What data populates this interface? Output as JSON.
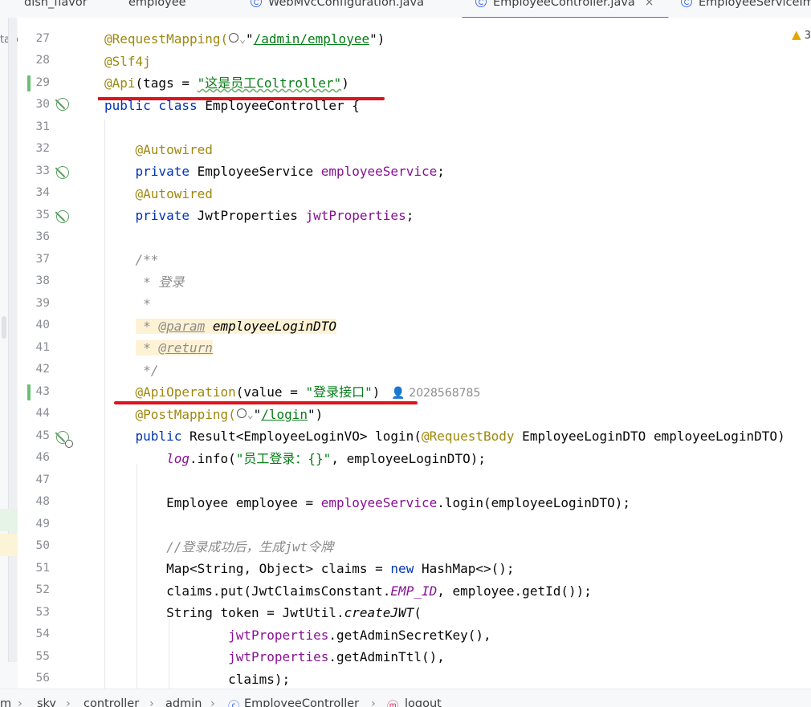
{
  "tabs": [
    {
      "label": "dish_flavor",
      "icon": "none",
      "active": false
    },
    {
      "label": "employee",
      "icon": "none",
      "active": false
    },
    {
      "label": "WebMvcConfiguration.java",
      "icon": "class-icon",
      "active": false
    },
    {
      "label": "EmployeeController.java",
      "icon": "class-icon",
      "active": true,
      "close": "×"
    },
    {
      "label": "EmployeeServiceIm",
      "icon": "class-icon",
      "active": false
    }
  ],
  "left_strip": {
    "fragment": "take"
  },
  "warnings": {
    "count": "3"
  },
  "line_numbers": [
    "27",
    "28",
    "29",
    "30",
    "31",
    "32",
    "33",
    "34",
    "35",
    "36",
    "37",
    "38",
    "39",
    "40",
    "41",
    "42",
    "43",
    "44",
    "45",
    "46",
    "47",
    "48",
    "49",
    "50",
    "51",
    "52",
    "53",
    "54",
    "55",
    "56"
  ],
  "code": {
    "l27": {
      "ann": "@RequestMapping(",
      "url": "/admin/employee",
      "end": "\")"
    },
    "l28": {
      "ann": "@Slf4j"
    },
    "l29": {
      "ann": "@Api",
      "mid": "(tags = ",
      "str": "\"这是员工Coltroller\"",
      "end": ")"
    },
    "l30": {
      "kw": "public class",
      "rest": " EmployeeController {"
    },
    "l32": {
      "ann": "@Autowired"
    },
    "l33": {
      "kw": "private",
      "type": " EmployeeService ",
      "field": "employeeService",
      "end": ";"
    },
    "l34": {
      "ann": "@Autowired"
    },
    "l35": {
      "kw": "private",
      "type": " JwtProperties ",
      "field": "jwtProperties",
      "end": ";"
    },
    "l37": {
      "doc": "/**"
    },
    "l38": {
      "doc": " * 登录"
    },
    "l39": {
      "doc": " *"
    },
    "l40": {
      "star": " * ",
      "tag": "@param",
      "param": "employeeLoginDTO"
    },
    "l41": {
      "star": " * ",
      "tag": "@return"
    },
    "l42": {
      "doc": " */"
    },
    "l43": {
      "ann": "@ApiOperation",
      "mid": "(value = ",
      "str": "\"登录接口\"",
      "end": ")",
      "author": "2028568785"
    },
    "l44": {
      "ann": "@PostMapping(",
      "url": "/login",
      "end": "\")"
    },
    "l45": {
      "kw": "public",
      "a": " Result<EmployeeLoginVO> login(",
      "ann": "@RequestBody",
      "b": " EmployeeLoginDTO employeeLoginDTO)"
    },
    "l46": {
      "field": "log",
      "a": ".info(",
      "str": "\"员工登录：{}\"",
      "b": ", employeeLoginDTO);"
    },
    "l48": {
      "a": "Employee employee = ",
      "field": "employeeService",
      "b": ".login(employeeLoginDTO);"
    },
    "l50": {
      "cmt": "//登录成功后，生成jwt令牌"
    },
    "l51": {
      "a": "Map<String, Object> claims = ",
      "kw": "new",
      "b": " HashMap<>();"
    },
    "l52": {
      "a": "claims.put(JwtClaimsConstant.",
      "static": "EMP_ID",
      "b": ", employee.getId());"
    },
    "l53": {
      "a": "String token = JwtUtil.",
      "m": "createJWT",
      "b": "("
    },
    "l54": {
      "field": "jwtProperties",
      "b": ".getAdminSecretKey(),"
    },
    "l55": {
      "field": "jwtProperties",
      "b": ".getAdminTtl(),"
    },
    "l56": {
      "a": "claims);"
    }
  },
  "breadcrumb": [
    "m",
    "sky",
    "controller",
    "admin",
    "EmployeeController",
    "logout"
  ],
  "colors": {
    "annotation": "#9e880d",
    "keyword": "#0033b3",
    "string": "#067d17",
    "field": "#871094",
    "red_mark": "#e0121b",
    "tab_accent": "#3574f0"
  }
}
